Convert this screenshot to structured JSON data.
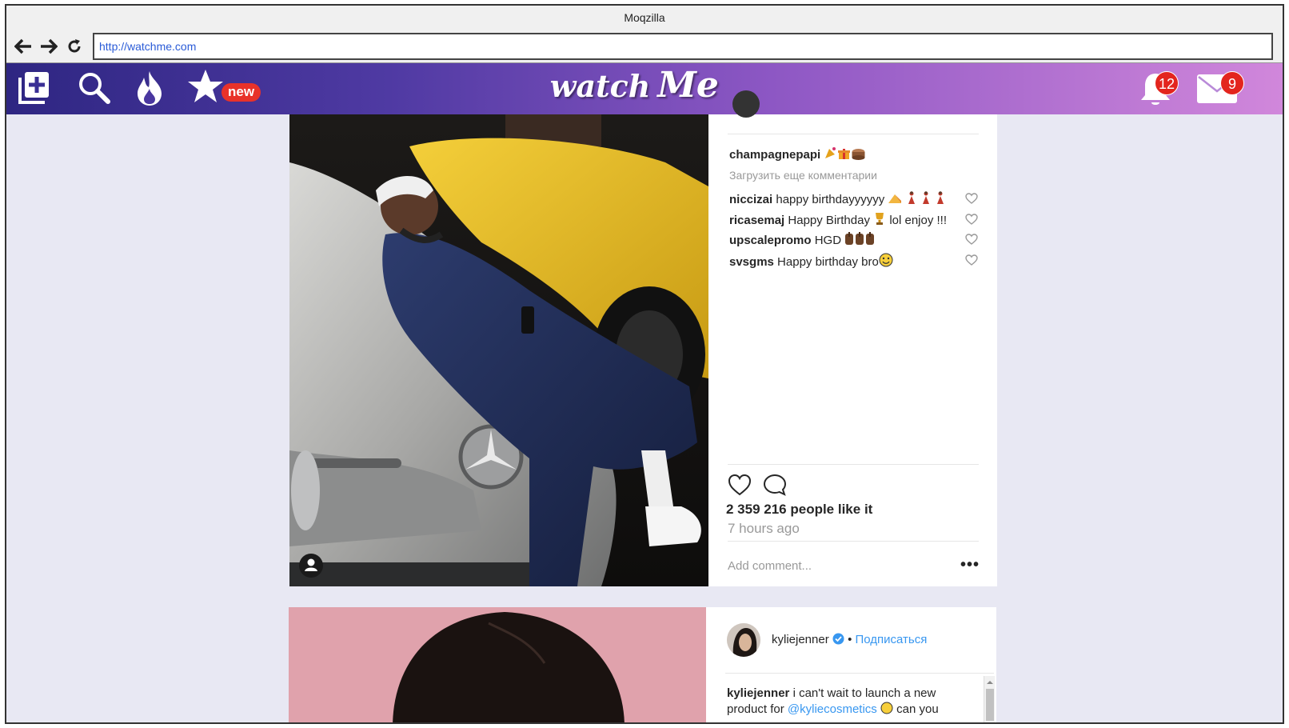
{
  "browser": {
    "title": "Moqzilla",
    "url": "http://watchme.com"
  },
  "app": {
    "logo_part1": "watch",
    "logo_part2": "Me",
    "new_tag": "new",
    "notifications_count": "12",
    "messages_count": "9",
    "icons": [
      "add-post-icon",
      "search-icon",
      "fire-icon",
      "star-icon",
      "bell-icon",
      "mail-icon"
    ]
  },
  "post1": {
    "caption_user": "champagnepapi",
    "load_more": "Загрузить еще комментарии",
    "comments": [
      {
        "user": "niccizai",
        "text": "happy birthdayyyyyy"
      },
      {
        "user": "ricasemaj",
        "text": "Happy Birthday",
        "text2": "lol enjoy !!!"
      },
      {
        "user": "upscalepromo",
        "text": "HGD"
      },
      {
        "user": "svsgms",
        "text": "Happy birthday bro"
      }
    ],
    "likes_text": "2 359 216 people like it",
    "time_text": "7 hours ago",
    "add_comment_placeholder": "Add comment...",
    "more_label": "•••"
  },
  "post2": {
    "username": "kyliejenner",
    "separator": "•",
    "follow_label": "Подписаться",
    "caption_user": "kyliejenner",
    "caption_text": "i can't wait to launch a new",
    "caption_line2a": "product for",
    "caption_mention": "@kyliecosmetics",
    "caption_line2b": "can you"
  },
  "colors": {
    "header_gradient_start": "#2e2682",
    "header_gradient_end": "#d187db",
    "badge": "#e3251e",
    "link": "#3897f0"
  }
}
